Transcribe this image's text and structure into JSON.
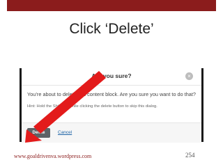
{
  "slide": {
    "title": "Click ‘Delete’",
    "footer_website": "www.goaldrivenva.wordpress.com",
    "page_number": "254",
    "accent_color": "#8b1c1c"
  },
  "dialog": {
    "title": "Are you sure?",
    "close_icon": "×",
    "message": "You’re about to delete this content block. Are you sure you want to do that?",
    "hint": "Hint: Hold the Shift key while clicking the delete button to skip this dialog.",
    "delete_label": "Delete",
    "cancel_label": "Cancel"
  },
  "annotation": {
    "arrow_color": "#e31b1b",
    "icon": "arrow-pointing-to-delete-icon"
  }
}
